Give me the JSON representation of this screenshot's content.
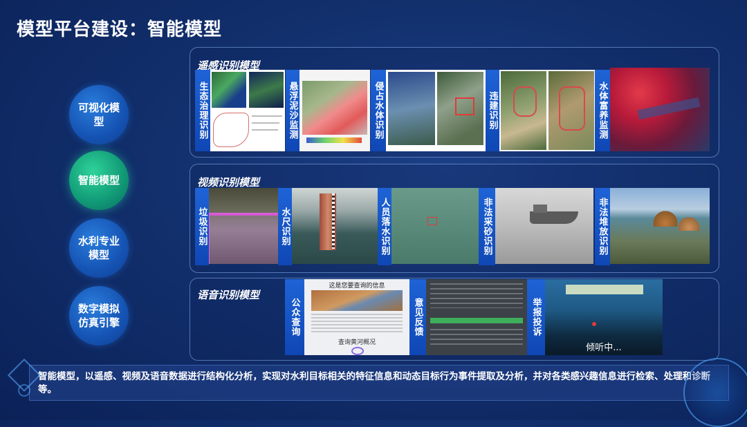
{
  "page": {
    "title": "模型平台建设：智能模型"
  },
  "nav": {
    "items": [
      {
        "label": "可视化模型",
        "active": false
      },
      {
        "label": "智能模型",
        "active": true
      },
      {
        "label": "水利专业模型",
        "active": false
      },
      {
        "label": "数字模拟仿真引擎",
        "active": false
      }
    ]
  },
  "panels": {
    "remote_sensing": {
      "title": "遥感识别模型",
      "items": [
        "生态治理识别",
        "悬浮泥沙监测",
        "侵占水体识别",
        "违建识别",
        "水体富养监测"
      ]
    },
    "video": {
      "title": "视频识别模型",
      "items": [
        "垃圾识别",
        "水尺识别",
        "人员落水识别",
        "非法采砂识别",
        "非法堆放识别"
      ]
    },
    "voice": {
      "title": "语音识别模型",
      "items": [
        "公众查询",
        "意见反馈",
        "举报投诉"
      ],
      "screens": {
        "query_header": "这是您要查询的信息",
        "query_footer": "查询黄河概况",
        "listening": "倾听中..."
      }
    }
  },
  "footer": {
    "description": "智能模型，以遥感、视频及语音数据进行结构化分析，实现对水利目标相关的特征信息和动态目标行为事件提取及分析，并对各类感兴趣信息进行检索、处理和诊断等。"
  },
  "colors": {
    "accent_blue": "#1e63d6",
    "active_green": "#19b98a",
    "background": "#12306d"
  }
}
